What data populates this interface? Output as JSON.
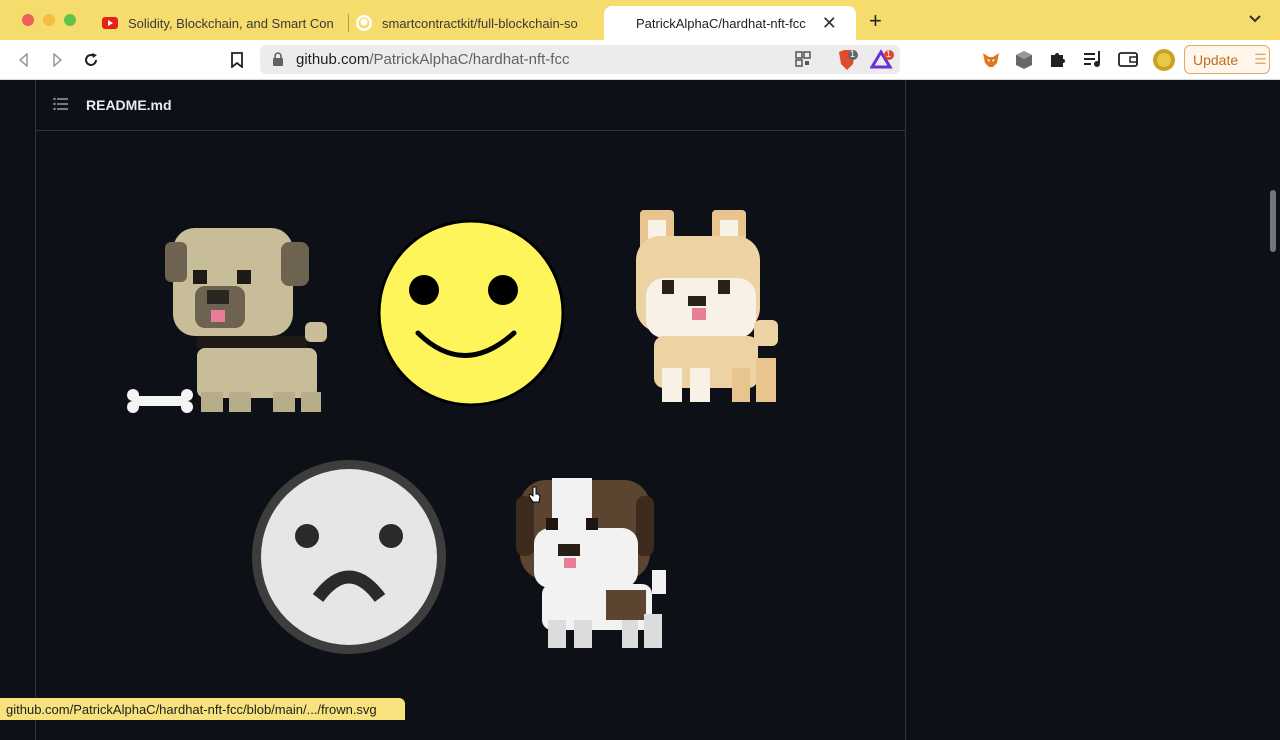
{
  "browser": {
    "tabs": [
      {
        "title": "Solidity, Blockchain, and Smart Con",
        "icon": "youtube-icon"
      },
      {
        "title": "smartcontractkit/full-blockchain-so",
        "icon": "github-icon"
      },
      {
        "title": "PatrickAlphaC/hardhat-nft-fcc",
        "icon": "none",
        "active": true
      }
    ],
    "url_host": "github.com",
    "url_path": "/PatrickAlphaC/hardhat-nft-fcc",
    "update_label": "Update",
    "brave_badge": "1",
    "rewards_badge": "1"
  },
  "readme": {
    "title": "README.md"
  },
  "images": [
    {
      "name": "pug",
      "alt": "pug-pixel-art"
    },
    {
      "name": "happy",
      "alt": "happy-smiley"
    },
    {
      "name": "shiba-inu",
      "alt": "shiba-inu-pixel-art"
    },
    {
      "name": "frown",
      "alt": "frown-face"
    },
    {
      "name": "st-bernard",
      "alt": "st-bernard-pixel-art"
    }
  ],
  "status": {
    "link": "github.com/PatrickAlphaC/hardhat-nft-fcc/blob/main/.../frown.svg"
  },
  "colors": {
    "tab_bar": "#f5dc6c",
    "page_bg": "#0d1117",
    "smiley_yellow": "#fdf55a",
    "frown_gray": "#e6e6e6"
  }
}
